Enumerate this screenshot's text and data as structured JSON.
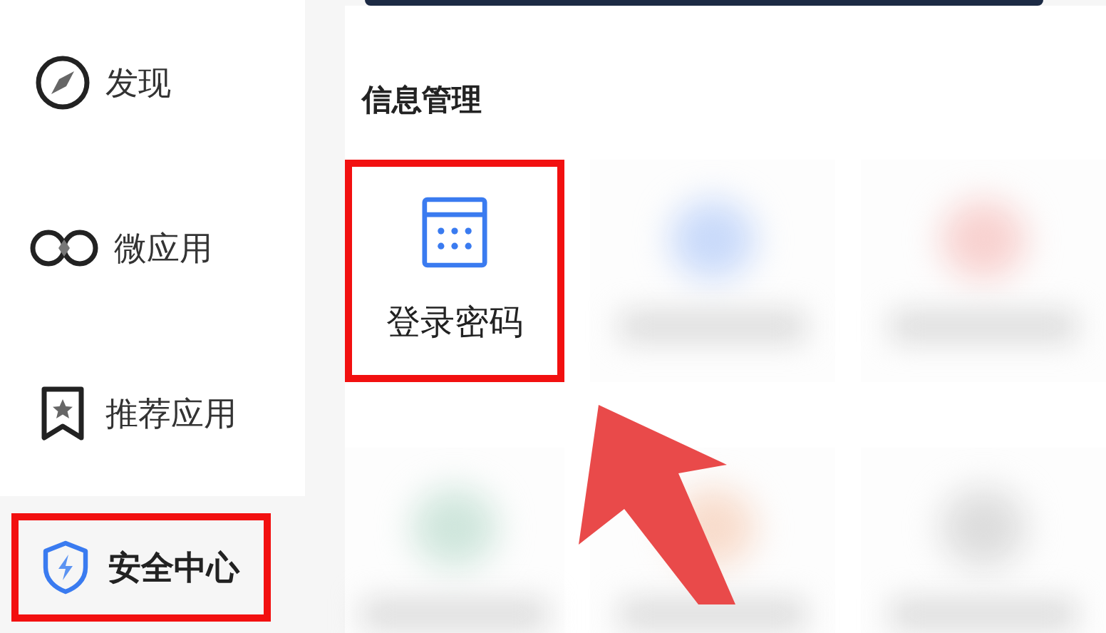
{
  "sidebar": {
    "items": [
      {
        "label": "发现",
        "selected": false,
        "highlighted": false
      },
      {
        "label": "微应用",
        "selected": false,
        "highlighted": false
      },
      {
        "label": "推荐应用",
        "selected": false,
        "highlighted": false
      },
      {
        "label": "安全中心",
        "selected": true,
        "highlighted": true
      }
    ]
  },
  "section": {
    "title": "信息管理",
    "tiles": [
      {
        "kind": "app",
        "label": "登录密码",
        "highlighted": true,
        "pointer_arrow": true
      },
      {
        "kind": "blurred",
        "color": "#c9dafa"
      },
      {
        "kind": "blurred",
        "color": "#f8d2d0"
      },
      {
        "kind": "blurred",
        "color": "#cfe6dc"
      },
      {
        "kind": "blurred",
        "color": "#f8dccc"
      },
      {
        "kind": "blurred",
        "color": "#dddddd"
      }
    ]
  }
}
